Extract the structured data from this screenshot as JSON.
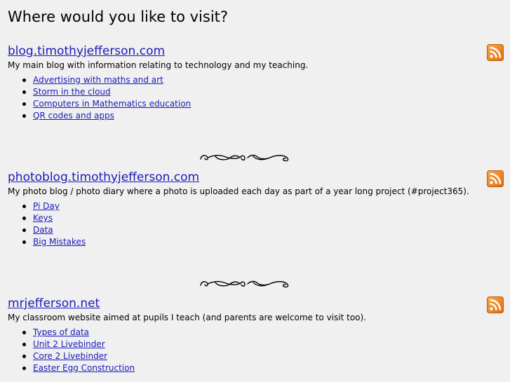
{
  "heading": "Where would you like to visit?",
  "sites": [
    {
      "title": "blog.timothyjefferson.com",
      "description": "My main blog with information relating to technology and my teaching.",
      "feed_icon": "rss-feed-icon",
      "posts": [
        "Advertising with maths and art",
        "Storm in the cloud",
        "Computers in Mathematics education",
        "QR codes and apps"
      ]
    },
    {
      "title": "photoblog.timothyjefferson.com",
      "description": "My photo blog / photo diary where a photo is uploaded each day as part of a year long project (#project365).",
      "feed_icon": "rss-feed-icon",
      "posts": [
        "Pi Day",
        "Keys",
        "Data",
        "Big Mistakes"
      ]
    },
    {
      "title": "mrjefferson.net",
      "description": "My classroom website aimed at pupils I teach (and parents are welcome to visit too).",
      "feed_icon": "rss-feed-icon",
      "posts": [
        "Types of data",
        "Unit 2 Livebinder",
        "Core 2 Livebinder",
        "Easter Egg Construction"
      ]
    }
  ],
  "divider_icon": "ornamental-divider-icon",
  "colors": {
    "background": "#f0f0f0",
    "link": "#1a1ab8",
    "rss_orange": "#f0861c"
  }
}
